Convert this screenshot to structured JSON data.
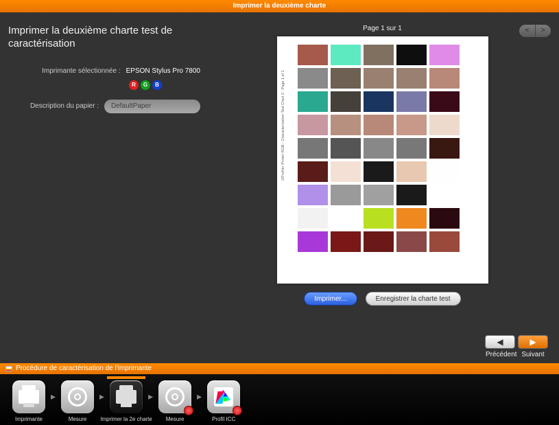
{
  "window_title": "Imprimer la deuxième charte",
  "page_title": "Imprimer la deuxième charte test de caractérisation",
  "printer": {
    "label": "Imprimante sélectionnée :",
    "value": "EPSON Stylus Pro 7800",
    "badges": {
      "r": "R",
      "g": "G",
      "b": "B"
    }
  },
  "paper": {
    "label": "Description du papier :",
    "placeholder": "DefaultPaper",
    "value": "DefaultPaper"
  },
  "page_counter": "Page 1 sur 1",
  "chart_side_text": "i1Profiler Printer RGB - Characterization Test Chart 2 - Page 1 of 1",
  "buttons": {
    "print": "Imprimer...",
    "save_chart": "Enregistrer la charte test"
  },
  "nav": {
    "prev": "Précédent",
    "next": "Suivant"
  },
  "procedure_label": "Procédure de caractérisation de l'imprimante",
  "steps": [
    {
      "label": "Imprimante"
    },
    {
      "label": "Mesure"
    },
    {
      "label": "Imprimer la 2e charte"
    },
    {
      "label": "Mesure"
    },
    {
      "label": "Profil ICC"
    }
  ],
  "chart_data": {
    "type": "color-swatch-grid",
    "cols": 5,
    "rows": 8,
    "swatches": [
      "#a55a4b",
      "#5eeac1",
      "#807060",
      "#0e0e0e",
      "#e08ce6",
      "#8a8a8a",
      "#6e6052",
      "#998070",
      "#998070",
      "#b88878",
      "#2aa890",
      "#45403a",
      "#1a3560",
      "#7a7aa8",
      "#3a0a18",
      "#c898a0",
      "#b89080",
      "#b88878",
      "#c89888",
      "#eedacc",
      "#777777",
      "#555555",
      "#888888",
      "#787878",
      "#3a1812",
      "#5a1c18",
      "#f4e0d4",
      "#1a1a1a",
      "#e8c8b0",
      "#fefefe",
      "#b090e8",
      "#9a9a9a",
      "#a0a0a0",
      "#1a1a1a",
      "",
      "#f2f2f2",
      "",
      "#b8e020",
      "#f08820",
      "#2a0a10",
      "#a838d8",
      "#7a1818",
      "#6a1818",
      "#8a4848",
      "#9a4a3a"
    ]
  }
}
